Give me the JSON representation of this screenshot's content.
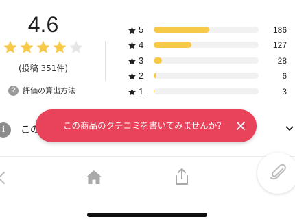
{
  "rating_summary": {
    "score": "4.6",
    "stars_filled": 4,
    "stars_total": 5,
    "post_count": "(投稿 351件)",
    "calc_link": "評価の算出方法",
    "help_icon_glyph": "?"
  },
  "distribution": [
    {
      "star_label": "5",
      "count": "186",
      "fraction": 0.53
    },
    {
      "star_label": "4",
      "count": "127",
      "fraction": 0.36
    },
    {
      "star_label": "3",
      "count": "28",
      "fraction": 0.08
    },
    {
      "star_label": "2",
      "count": "6",
      "fraction": 0.017
    },
    {
      "star_label": "1",
      "count": "3",
      "fraction": 0.009
    }
  ],
  "section": {
    "label_visible": "この",
    "info_icon_glyph": "i"
  },
  "toast": {
    "message": "この商品のクチコミを書いてみませんか？"
  },
  "tabbar": {
    "icons": [
      "back-icon",
      "home-icon",
      "share-icon",
      "paperclip-icon"
    ]
  },
  "colors": {
    "star_filled": "#f7c948",
    "star_empty": "#e6e6e6",
    "bar_fill": "#f7c948",
    "bar_track": "#f1f1f1",
    "toast_bg": "#e8435a",
    "icon_gray": "#9a9a9a"
  }
}
